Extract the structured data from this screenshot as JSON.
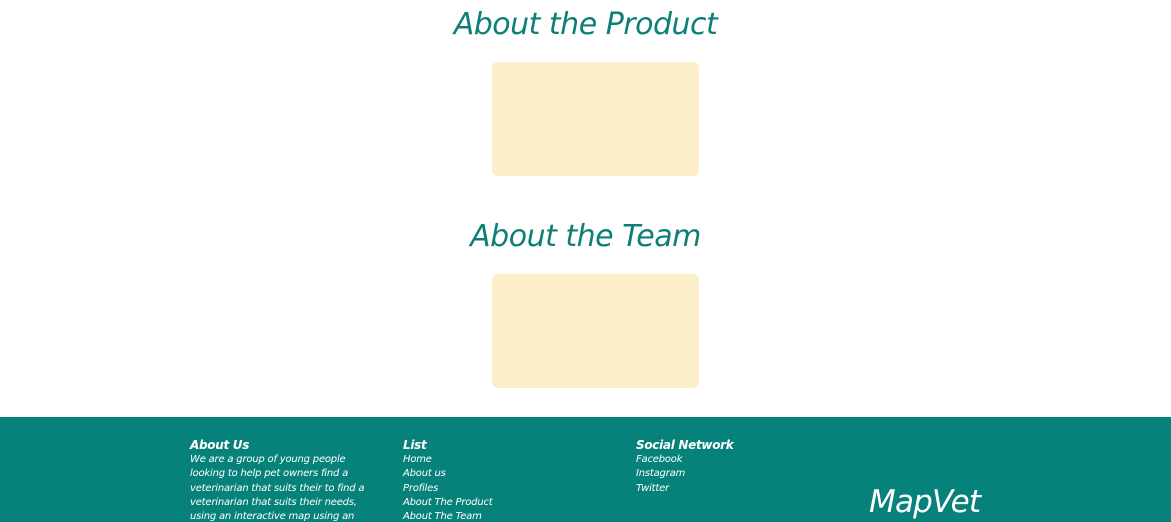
{
  "sections": {
    "product_title": "About the Product",
    "team_title": "About the Team"
  },
  "footer": {
    "about": {
      "heading": "About Us",
      "text": "We are a group of young people looking to help pet owners find a veterinarian that suits their to find a veterinarian that suits their needs, using an interactive map using an interactive map where you"
    },
    "list": {
      "heading": "List",
      "items": [
        "Home",
        "About us",
        "Profiles",
        "About The Product",
        "About The Team"
      ]
    },
    "social": {
      "heading": "Social Network",
      "items": [
        "Facebook",
        "Instagram",
        "Twitter"
      ]
    },
    "brand": "MapVet"
  },
  "colors": {
    "accent": "#0e7f77",
    "footer_bg": "#07827a",
    "card_bg": "#fdeeca"
  }
}
